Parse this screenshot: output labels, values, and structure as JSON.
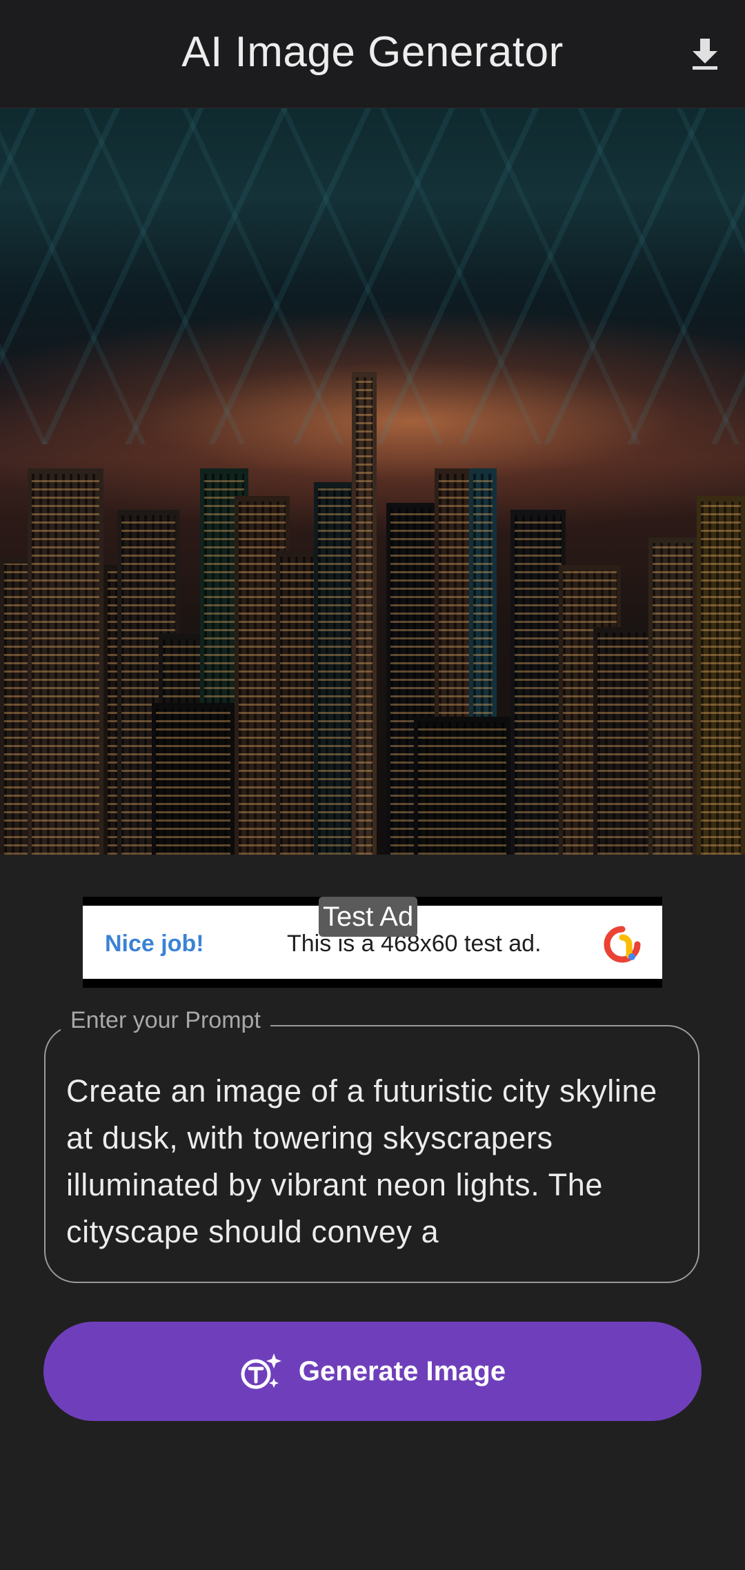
{
  "app": {
    "title": "AI Image Generator",
    "download_icon": "download-icon"
  },
  "image": {
    "description_icon": "generated-image"
  },
  "ad": {
    "badge": "Test Ad",
    "nice": "Nice job!",
    "text": "This is a 468x60 test ad.",
    "logo_icon": "admob-logo-icon"
  },
  "prompt": {
    "label": "Enter your Prompt",
    "value": "Create an image of a futuristic city skyline at dusk, with towering skyscrapers illuminated by vibrant neon lights. The cityscape should convey a"
  },
  "generate": {
    "label": "Generate Image",
    "icon": "text-sparkle-icon"
  },
  "colors": {
    "background": "#202020",
    "appbar": "#1c1c1e",
    "primary_button": "#6f3fbb",
    "ad_accent": "#3b82d6"
  }
}
